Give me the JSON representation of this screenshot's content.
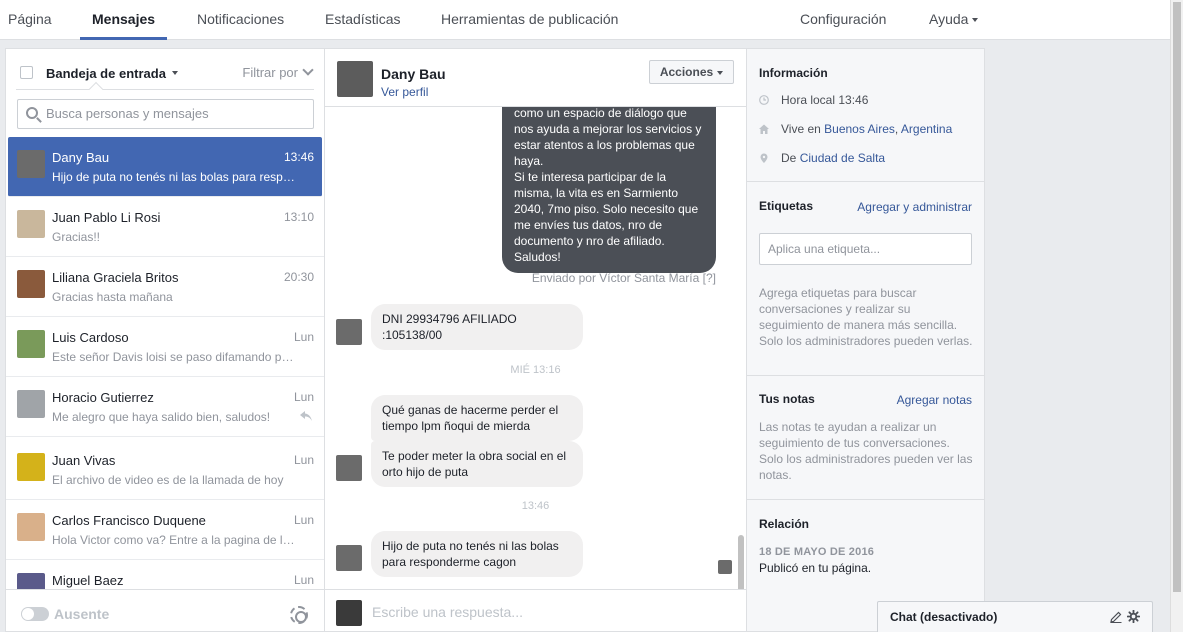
{
  "topnav": {
    "tabs": [
      {
        "label": "Página"
      },
      {
        "label": "Mensajes"
      },
      {
        "label": "Notificaciones"
      },
      {
        "label": "Estadísticas"
      },
      {
        "label": "Herramientas de publicación"
      }
    ],
    "settings": "Configuración",
    "help": "Ayuda"
  },
  "inbox": {
    "title": "Bandeja de entrada",
    "filter": "Filtrar por",
    "search_placeholder": "Busca personas y mensajes",
    "conversations": [
      {
        "name": "Dany Bau",
        "snippet": "Hijo de puta no tenés ni las bolas para responderme cagon",
        "time": "13:46",
        "active": true,
        "avatar_color": "#6b6b6b"
      },
      {
        "name": "Juan Pablo Li Rosi",
        "snippet": "Gracias!!",
        "time": "13:10",
        "active": false,
        "avatar_color": "#c9b79c"
      },
      {
        "name": "Liliana Graciela Britos",
        "snippet": "Gracias hasta mañana",
        "time": "20:30",
        "active": false,
        "avatar_color": "#8a5a3c"
      },
      {
        "name": "Luis Cardoso",
        "snippet": "Este señor Davis loisi se paso difamando por facebook",
        "time": "Lun",
        "active": false,
        "avatar_color": "#7a9a5a"
      },
      {
        "name": "Horacio Gutierrez",
        "snippet": "Me alegro que haya salido bien, saludos!",
        "time": "Lun",
        "active": false,
        "avatar_color": "#a0a4a8"
      },
      {
        "name": "Juan Vivas",
        "snippet": "El archivo de video es de la llamada de hoy",
        "time": "Lun",
        "active": false,
        "avatar_color": "#d4b21a"
      },
      {
        "name": "Carlos Francisco Duquene",
        "snippet": "Hola Victor como va? Entre a la pagina de la obra",
        "time": "Lun",
        "active": false,
        "avatar_color": "#d9b08a"
      },
      {
        "name": "Miguel Baez",
        "snippet": "",
        "time": "Lun",
        "active": false,
        "avatar_color": "#5a5a8a"
      }
    ],
    "away": "Ausente"
  },
  "thread": {
    "name": "Dany Bau",
    "profile_link": "Ver perfil",
    "actions": "Acciones",
    "outgoing_text": "como un espacio de diálogo que nos ayuda a mejorar los servicios y estar atentos a los problemas que haya.\nSi te interesa participar de la misma, la vita es en Sarmiento 2040, 7mo piso. Solo necesito que me envíes tus datos, nro de documento y nro de afiliado. Saludos!",
    "sent_by": "Enviado por Víctor Santa María",
    "sent_by_help": "[?]",
    "msg_dni": "DNI 29934796 AFILIADO :105138/00",
    "stamp_1": "MIÉ 13:16",
    "msg_2": "Qué ganas de hacerme perder el tiempo lpm ñoqui de mierda",
    "msg_3": "Te poder meter la obra social en el orto hijo de puta",
    "stamp_2": "13:46",
    "msg_4": "Hijo de puta no tenés ni las bolas para responderme cagon",
    "composer_placeholder": "Escribe una respuesta..."
  },
  "info": {
    "title": "Información",
    "local_time": "Hora local 13:46",
    "lives_prefix": "Vive en",
    "lives_city": "Buenos Aires",
    "lives_sep": ",",
    "lives_country": "Argentina",
    "from_prefix": "De",
    "from_city": "Ciudad de Salta",
    "labels_title": "Etiquetas",
    "labels_link": "Agregar y administrar",
    "labels_placeholder": "Aplica una etiqueta...",
    "labels_help": "Agrega etiquetas para buscar conversaciones y realizar su seguimiento de manera más sencilla. Solo los administradores pueden verlas.",
    "notes_title": "Tus notas",
    "notes_link": "Agregar notas",
    "notes_help": "Las notas te ayudan a realizar un seguimiento de tus conversaciones. Solo los administradores pueden ver las notas.",
    "relation_title": "Relación",
    "relation_date": "18 DE MAYO DE 2016",
    "relation_text": "Publicó en tu página."
  },
  "chatbar": {
    "label": "Chat (desactivado)"
  },
  "colors": {
    "accent": "#4267b2",
    "link": "#365899",
    "outgoing_bubble": "#4b4f56",
    "incoming_bubble": "#f1f0f0"
  },
  "icons": [
    "search-icon",
    "chevron-down-icon",
    "clock-icon",
    "home-icon",
    "pin-icon",
    "reply-icon",
    "paperclip-icon",
    "emoji-icon",
    "edit-icon",
    "gear-icon"
  ]
}
